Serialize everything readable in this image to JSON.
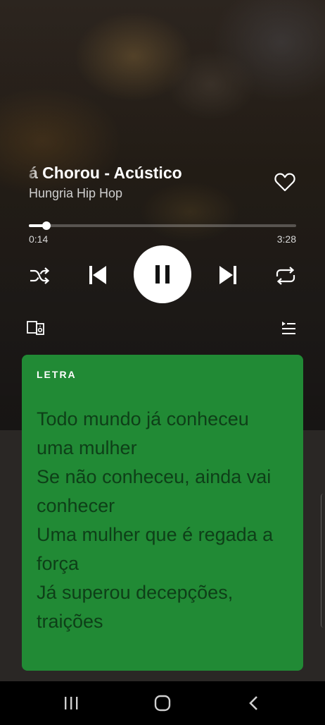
{
  "player": {
    "track_title": "á Chorou - Acústico",
    "artist": "Hungria Hip Hop",
    "liked": false,
    "elapsed": "0:14",
    "duration": "3:28",
    "progress_fraction": 0.067,
    "state": "playing"
  },
  "icons": {
    "like": "heart-outline-icon",
    "shuffle": "shuffle-icon",
    "previous": "skip-previous-icon",
    "pause": "pause-icon",
    "next": "skip-next-icon",
    "repeat": "repeat-icon",
    "devices": "devices-icon",
    "queue": "queue-icon"
  },
  "lyrics": {
    "heading": "LETRA",
    "lines": [
      "Todo mundo já conheceu",
      "uma mulher",
      "Se não conheceu, ainda vai",
      "conhecer",
      "Uma mulher que é regada a",
      "força",
      "Já superou decepções,",
      "traições"
    ]
  },
  "colors": {
    "lyrics_card": "#218a35",
    "lyrics_text": "#0e3f18",
    "accent_white": "#ffffff"
  },
  "system_nav": {
    "recents": "recents-icon",
    "home": "home-icon",
    "back": "back-icon"
  }
}
